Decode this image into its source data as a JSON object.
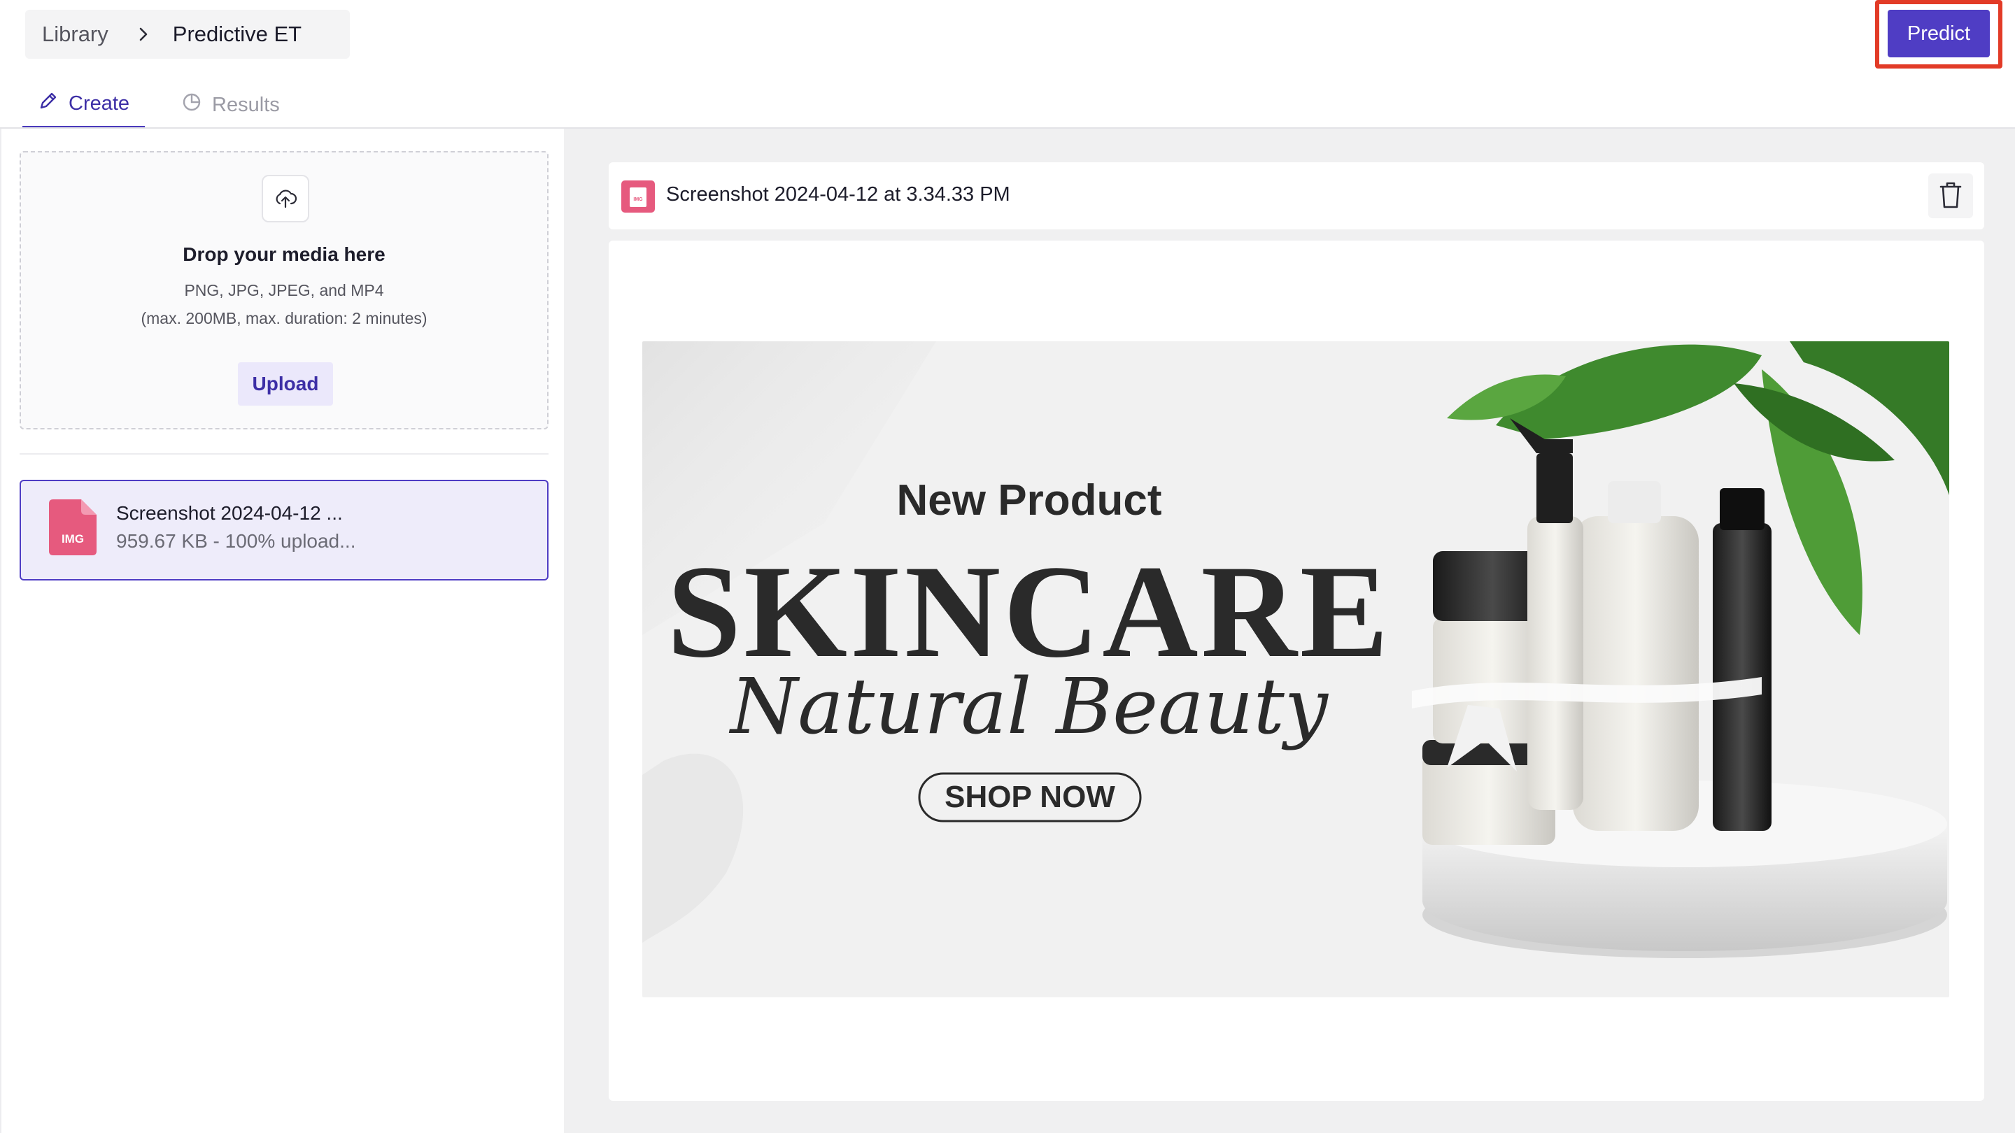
{
  "breadcrumb": {
    "root": "Library",
    "current": "Predictive ET"
  },
  "header": {
    "predict_label": "Predict",
    "accent_color": "#4f3dc4",
    "highlight_color": "#e23b27"
  },
  "tabs": [
    {
      "label": "Create",
      "icon": "pencil-icon",
      "active": true
    },
    {
      "label": "Results",
      "icon": "pie-chart-icon",
      "active": false
    }
  ],
  "dropzone": {
    "title": "Drop your media here",
    "formats": "PNG, JPG, JPEG, and MP4",
    "limits": "(max. 200MB, max. duration: 2 minutes)",
    "upload_label": "Upload",
    "icon": "upload-cloud-icon"
  },
  "files": [
    {
      "name": "Screenshot 2024-04-12 ...",
      "meta": "959.67 KB - 100% upload...",
      "type_label": "IMG",
      "icon": "image-file-icon"
    }
  ],
  "preview": {
    "file_name": "Screenshot 2024-04-12 at 3.34.33 PM",
    "type_label": "IMG",
    "delete_icon": "trash-icon",
    "banner": {
      "kicker": "New Product",
      "headline": "SKINCARE",
      "script": "Natural Beauty",
      "cta": "SHOP NOW"
    }
  }
}
